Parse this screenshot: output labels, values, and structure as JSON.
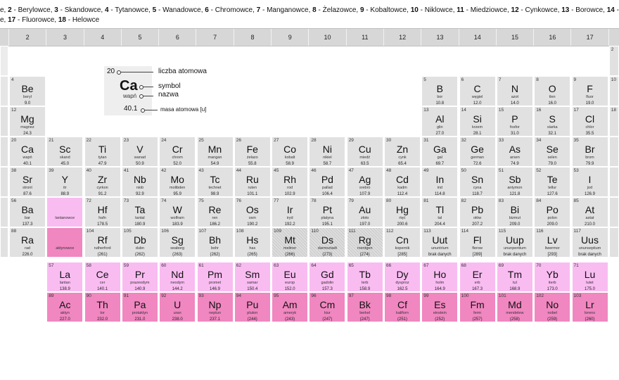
{
  "top_note": {
    "line1": [
      {
        "n": "",
        "t": "e, "
      },
      {
        "n": "2",
        "t": " - Berylowce, "
      },
      {
        "n": "3",
        "t": " - Skandowce, "
      },
      {
        "n": "4",
        "t": " - Tytanowce, "
      },
      {
        "n": "5",
        "t": " - Wanadowce, "
      },
      {
        "n": "6",
        "t": " - Chromowce, "
      },
      {
        "n": "7",
        "t": " - Manganowce, "
      },
      {
        "n": "8",
        "t": " - Żelazowce, "
      },
      {
        "n": "9",
        "t": " - Kobaltowce, "
      },
      {
        "n": "10",
        "t": " - Niklowce, "
      },
      {
        "n": "11",
        "t": " - Miedziowce, "
      },
      {
        "n": "12",
        "t": " - Cynkowce, "
      },
      {
        "n": "13",
        "t": " - Borowce, "
      },
      {
        "n": "14",
        "t": " - Węglowce, "
      },
      {
        "n": "15",
        "t": " - Azoto"
      }
    ],
    "line2": [
      {
        "n": "",
        "t": "e, "
      },
      {
        "n": "17",
        "t": " - Fluorowce, "
      },
      {
        "n": "18",
        "t": " - Helowce"
      }
    ]
  },
  "group_headers": [
    "2",
    "3",
    "4",
    "5",
    "6",
    "7",
    "8",
    "9",
    "10",
    "11",
    "12",
    "13",
    "14",
    "15",
    "16",
    "17"
  ],
  "legend": {
    "number": "20",
    "symbol": "Ca",
    "name": "wapń",
    "mass": "40.1",
    "label_number": "liczba atomowa",
    "label_symbol": "symbol",
    "label_name": "nazwa",
    "label_mass": "masa atomowa [u]"
  },
  "right_edge_numbers": {
    "row1": "2",
    "row2": "10",
    "row3": "18"
  },
  "lanthanide_label": {
    "number": "",
    "symbol": "La-Lu",
    "name": "lantanowce"
  },
  "actinide_label": {
    "number": "",
    "symbol": "Ac-Lr",
    "name": "aktynowce"
  },
  "elements": [
    {
      "n": "4",
      "s": "Be",
      "name": "beryl",
      "m": "9.0",
      "c": 0,
      "r": 1
    },
    {
      "n": "12",
      "s": "Mg",
      "name": "magnez",
      "m": "24.3",
      "c": 0,
      "r": 2
    },
    {
      "n": "20",
      "s": "Ca",
      "name": "wapń",
      "m": "40.1",
      "c": 0,
      "r": 3
    },
    {
      "n": "38",
      "s": "Sr",
      "name": "stront",
      "m": "87.6",
      "c": 0,
      "r": 4
    },
    {
      "n": "56",
      "s": "Ba",
      "name": "bar",
      "m": "137.3",
      "c": 0,
      "r": 5
    },
    {
      "n": "88",
      "s": "Ra",
      "name": "rad",
      "m": "226.0",
      "c": 0,
      "r": 6
    },
    {
      "n": "5",
      "s": "B",
      "name": "bor",
      "m": "10.8",
      "c": 11,
      "r": 1
    },
    {
      "n": "6",
      "s": "C",
      "name": "węgiel",
      "m": "12.0",
      "c": 12,
      "r": 1
    },
    {
      "n": "7",
      "s": "N",
      "name": "azot",
      "m": "14.0",
      "c": 13,
      "r": 1
    },
    {
      "n": "8",
      "s": "O",
      "name": "tlen",
      "m": "16.0",
      "c": 14,
      "r": 1
    },
    {
      "n": "9",
      "s": "F",
      "name": "fluor",
      "m": "19.0",
      "c": 15,
      "r": 1
    },
    {
      "n": "13",
      "s": "Al",
      "name": "glin",
      "m": "27.0",
      "c": 11,
      "r": 2
    },
    {
      "n": "14",
      "s": "Si",
      "name": "krzem",
      "m": "28.1",
      "c": 12,
      "r": 2
    },
    {
      "n": "15",
      "s": "P",
      "name": "fosfor",
      "m": "31.0",
      "c": 13,
      "r": 2
    },
    {
      "n": "16",
      "s": "S",
      "name": "siarka",
      "m": "32.1",
      "c": 14,
      "r": 2
    },
    {
      "n": "17",
      "s": "Cl",
      "name": "chlor",
      "m": "35.5",
      "c": 15,
      "r": 2
    },
    {
      "n": "21",
      "s": "Sc",
      "name": "skand",
      "m": "45.0",
      "c": 1,
      "r": 3
    },
    {
      "n": "22",
      "s": "Ti",
      "name": "tytan",
      "m": "47.9",
      "c": 2,
      "r": 3
    },
    {
      "n": "23",
      "s": "V",
      "name": "wanad",
      "m": "50.9",
      "c": 3,
      "r": 3
    },
    {
      "n": "24",
      "s": "Cr",
      "name": "chrom",
      "m": "52.0",
      "c": 4,
      "r": 3
    },
    {
      "n": "25",
      "s": "Mn",
      "name": "mangan",
      "m": "54.9",
      "c": 5,
      "r": 3
    },
    {
      "n": "26",
      "s": "Fe",
      "name": "żelazo",
      "m": "55.8",
      "c": 6,
      "r": 3
    },
    {
      "n": "27",
      "s": "Co",
      "name": "kobalt",
      "m": "58.9",
      "c": 7,
      "r": 3
    },
    {
      "n": "28",
      "s": "Ni",
      "name": "nikiel",
      "m": "58.7",
      "c": 8,
      "r": 3
    },
    {
      "n": "29",
      "s": "Cu",
      "name": "miedź",
      "m": "63.5",
      "c": 9,
      "r": 3
    },
    {
      "n": "30",
      "s": "Zn",
      "name": "cynk",
      "m": "65.4",
      "c": 10,
      "r": 3
    },
    {
      "n": "31",
      "s": "Ga",
      "name": "gal",
      "m": "69.7",
      "c": 11,
      "r": 3
    },
    {
      "n": "32",
      "s": "Ge",
      "name": "german",
      "m": "72.6",
      "c": 12,
      "r": 3
    },
    {
      "n": "33",
      "s": "As",
      "name": "arsen",
      "m": "74.9",
      "c": 13,
      "r": 3
    },
    {
      "n": "34",
      "s": "Se",
      "name": "selen",
      "m": "79.0",
      "c": 14,
      "r": 3
    },
    {
      "n": "35",
      "s": "Br",
      "name": "brom",
      "m": "79.9",
      "c": 15,
      "r": 3
    },
    {
      "n": "39",
      "s": "Y",
      "name": "itr",
      "m": "88.9",
      "c": 1,
      "r": 4
    },
    {
      "n": "40",
      "s": "Zr",
      "name": "cyrkon",
      "m": "91.2",
      "c": 2,
      "r": 4
    },
    {
      "n": "41",
      "s": "Nb",
      "name": "niob",
      "m": "92.9",
      "c": 3,
      "r": 4
    },
    {
      "n": "42",
      "s": "Mo",
      "name": "molibden",
      "m": "95.9",
      "c": 4,
      "r": 4
    },
    {
      "n": "43",
      "s": "Tc",
      "name": "technet",
      "m": "98.9",
      "c": 5,
      "r": 4
    },
    {
      "n": "44",
      "s": "Ru",
      "name": "ruten",
      "m": "101.1",
      "c": 6,
      "r": 4
    },
    {
      "n": "45",
      "s": "Rh",
      "name": "rod",
      "m": "102.9",
      "c": 7,
      "r": 4
    },
    {
      "n": "46",
      "s": "Pd",
      "name": "pallad",
      "m": "106.4",
      "c": 8,
      "r": 4
    },
    {
      "n": "47",
      "s": "Ag",
      "name": "srebro",
      "m": "107.9",
      "c": 9,
      "r": 4
    },
    {
      "n": "48",
      "s": "Cd",
      "name": "kadm",
      "m": "112.4",
      "c": 10,
      "r": 4
    },
    {
      "n": "49",
      "s": "In",
      "name": "ind",
      "m": "114.8",
      "c": 11,
      "r": 4
    },
    {
      "n": "50",
      "s": "Sn",
      "name": "cyna",
      "m": "118.7",
      "c": 12,
      "r": 4
    },
    {
      "n": "51",
      "s": "Sb",
      "name": "antymon",
      "m": "121.8",
      "c": 13,
      "r": 4
    },
    {
      "n": "52",
      "s": "Te",
      "name": "tellur",
      "m": "127.6",
      "c": 14,
      "r": 4
    },
    {
      "n": "53",
      "s": "I",
      "name": "jod",
      "m": "126.9",
      "c": 15,
      "r": 4
    },
    {
      "n": "72",
      "s": "Hf",
      "name": "hafn",
      "m": "178.5",
      "c": 2,
      "r": 5
    },
    {
      "n": "73",
      "s": "Ta",
      "name": "tantal",
      "m": "180.9",
      "c": 3,
      "r": 5
    },
    {
      "n": "74",
      "s": "W",
      "name": "wolfram",
      "m": "183.9",
      "c": 4,
      "r": 5
    },
    {
      "n": "75",
      "s": "Re",
      "name": "ren",
      "m": "186.2",
      "c": 5,
      "r": 5
    },
    {
      "n": "76",
      "s": "Os",
      "name": "osm",
      "m": "190.2",
      "c": 6,
      "r": 5
    },
    {
      "n": "77",
      "s": "Ir",
      "name": "iryd",
      "m": "192.2",
      "c": 7,
      "r": 5
    },
    {
      "n": "78",
      "s": "Pt",
      "name": "platyna",
      "m": "195.1",
      "c": 8,
      "r": 5
    },
    {
      "n": "79",
      "s": "Au",
      "name": "złoto",
      "m": "197.0",
      "c": 9,
      "r": 5
    },
    {
      "n": "80",
      "s": "Hg",
      "name": "rtęć",
      "m": "200.6",
      "c": 10,
      "r": 5
    },
    {
      "n": "81",
      "s": "Tl",
      "name": "tal",
      "m": "204.4",
      "c": 11,
      "r": 5
    },
    {
      "n": "82",
      "s": "Pb",
      "name": "ołów",
      "m": "207.2",
      "c": 12,
      "r": 5
    },
    {
      "n": "83",
      "s": "Bi",
      "name": "bizmut",
      "m": "209.0",
      "c": 13,
      "r": 5
    },
    {
      "n": "84",
      "s": "Po",
      "name": "polon",
      "m": "209.0",
      "c": 14,
      "r": 5
    },
    {
      "n": "85",
      "s": "At",
      "name": "astat",
      "m": "210.0",
      "c": 15,
      "r": 5
    },
    {
      "n": "104",
      "s": "Rf",
      "name": "rutherford",
      "m": "(261)",
      "c": 2,
      "r": 6
    },
    {
      "n": "105",
      "s": "Db",
      "name": "dubn",
      "m": "(262)",
      "c": 3,
      "r": 6
    },
    {
      "n": "106",
      "s": "Sg",
      "name": "seaborg",
      "m": "(263)",
      "c": 4,
      "r": 6
    },
    {
      "n": "107",
      "s": "Bh",
      "name": "bohr",
      "m": "(262)",
      "c": 5,
      "r": 6
    },
    {
      "n": "108",
      "s": "Hs",
      "name": "has",
      "m": "(265)",
      "c": 6,
      "r": 6
    },
    {
      "n": "109",
      "s": "Mt",
      "name": "meitner",
      "m": "(266)",
      "c": 7,
      "r": 6,
      "h": 1
    },
    {
      "n": "110",
      "s": "Ds",
      "name": "darmsztadt",
      "m": "(273)",
      "c": 8,
      "r": 6,
      "h": 1
    },
    {
      "n": "111",
      "s": "Rg",
      "name": "roentgen",
      "m": "(274)",
      "c": 9,
      "r": 6,
      "h": 1
    },
    {
      "n": "112",
      "s": "Cn",
      "name": "kopernik",
      "m": "[285]",
      "c": 10,
      "r": 6
    },
    {
      "n": "113",
      "s": "Uut",
      "name": "ununtrium",
      "m": "brak danych",
      "c": 11,
      "r": 6
    },
    {
      "n": "114",
      "s": "Fl",
      "name": "flerow",
      "m": "[289]",
      "c": 12,
      "r": 6
    },
    {
      "n": "115",
      "s": "Uup",
      "name": "ununpentium",
      "m": "brak danych",
      "c": 13,
      "r": 6
    },
    {
      "n": "116",
      "s": "Lv",
      "name": "liwermor",
      "m": "[293]",
      "c": 14,
      "r": 6
    },
    {
      "n": "117",
      "s": "Uus",
      "name": "ununseptium",
      "m": "brak danych",
      "c": 15,
      "r": 6
    }
  ],
  "lanthanides": [
    {
      "n": "57",
      "s": "La",
      "name": "lantan",
      "m": "138.9"
    },
    {
      "n": "58",
      "s": "Ce",
      "name": "cer",
      "m": "140.1"
    },
    {
      "n": "59",
      "s": "Pr",
      "name": "prazeodym",
      "m": "140.9"
    },
    {
      "n": "60",
      "s": "Nd",
      "name": "neodym",
      "m": "144.2"
    },
    {
      "n": "61",
      "s": "Pm",
      "name": "promet",
      "m": "146.9"
    },
    {
      "n": "62",
      "s": "Sm",
      "name": "samar",
      "m": "150.4"
    },
    {
      "n": "63",
      "s": "Eu",
      "name": "europ",
      "m": "152.0"
    },
    {
      "n": "64",
      "s": "Gd",
      "name": "gadolin",
      "m": "157.3"
    },
    {
      "n": "65",
      "s": "Tb",
      "name": "terb",
      "m": "158.9"
    },
    {
      "n": "66",
      "s": "Dy",
      "name": "dysproz",
      "m": "162.5"
    },
    {
      "n": "67",
      "s": "Ho",
      "name": "holm",
      "m": "164.9"
    },
    {
      "n": "68",
      "s": "Er",
      "name": "erb",
      "m": "167.3"
    },
    {
      "n": "69",
      "s": "Tm",
      "name": "tul",
      "m": "168.9"
    },
    {
      "n": "70",
      "s": "Yb",
      "name": "iterb",
      "m": "173.0"
    },
    {
      "n": "71",
      "s": "Lu",
      "name": "lutet",
      "m": "175.0"
    }
  ],
  "actinides": [
    {
      "n": "89",
      "s": "Ac",
      "name": "aktyn",
      "m": "227.0"
    },
    {
      "n": "90",
      "s": "Th",
      "name": "tor",
      "m": "232.0"
    },
    {
      "n": "91",
      "s": "Pa",
      "name": "protaktyn",
      "m": "231.0"
    },
    {
      "n": "92",
      "s": "U",
      "name": "uran",
      "m": "238.0"
    },
    {
      "n": "93",
      "s": "Np",
      "name": "neptun",
      "m": "237.1"
    },
    {
      "n": "94",
      "s": "Pu",
      "name": "pluton",
      "m": "(244)"
    },
    {
      "n": "95",
      "s": "Am",
      "name": "ameryk",
      "m": "(243)"
    },
    {
      "n": "96",
      "s": "Cm",
      "name": "kiur",
      "m": "(247)"
    },
    {
      "n": "97",
      "s": "Bk",
      "name": "berkel",
      "m": "(247)"
    },
    {
      "n": "98",
      "s": "Cf",
      "name": "kaliforn",
      "m": "(251)"
    },
    {
      "n": "99",
      "s": "Es",
      "name": "einstein",
      "m": "(252)"
    },
    {
      "n": "100",
      "s": "Fm",
      "name": "ferm",
      "m": "(257)"
    },
    {
      "n": "101",
      "s": "Md",
      "name": "mendelew",
      "m": "(258)"
    },
    {
      "n": "102",
      "s": "No",
      "name": "nobel",
      "m": "(259)"
    },
    {
      "n": "103",
      "s": "Lr",
      "name": "lorens",
      "m": "(260)"
    }
  ],
  "colors": {
    "main_cell": "#e1e1e1",
    "lanthanide": "#f9bcf1",
    "actinide": "#f087c0",
    "header": "#d7d7d7"
  }
}
